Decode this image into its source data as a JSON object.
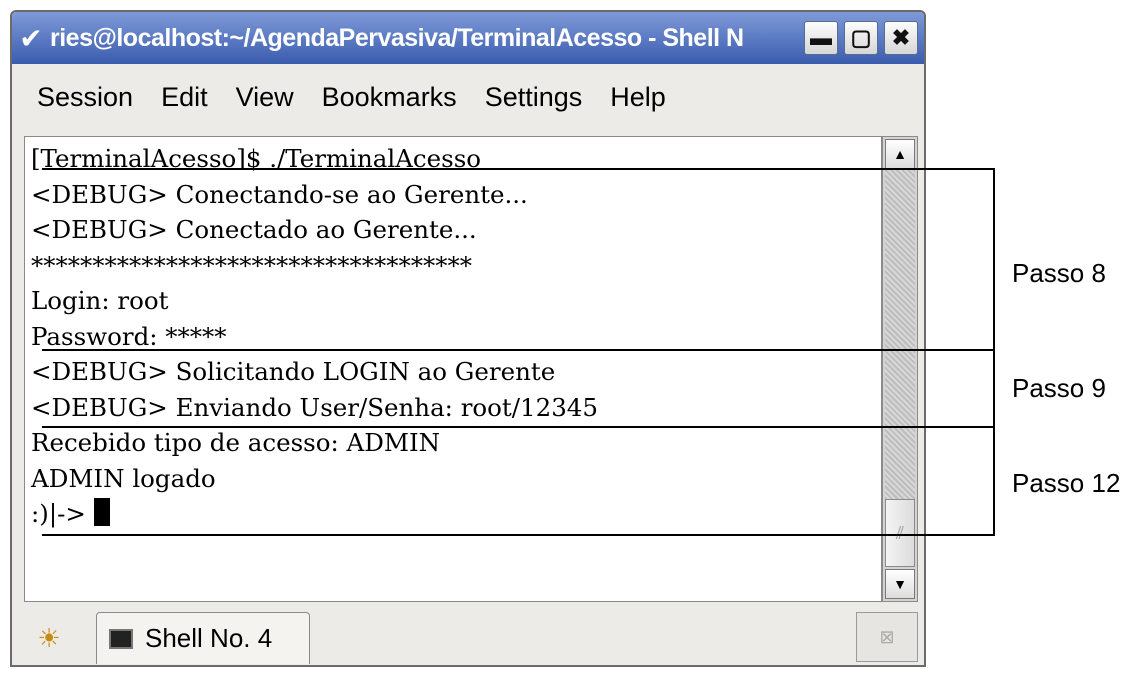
{
  "window": {
    "title": "ries@localhost:~/AgendaPervasiva/TerminalAcesso - Shell N",
    "menu_button_glyph": "✔",
    "minimize_glyph": "▬",
    "maximize_glyph": "▢",
    "close_glyph": "✖"
  },
  "menubar": {
    "items": [
      "Session",
      "Edit",
      "View",
      "Bookmarks",
      "Settings",
      "Help"
    ]
  },
  "terminal": {
    "lines": [
      "[TerminalAcesso]$ ./TerminalAcesso",
      "<DEBUG> Conectando-se ao Gerente...",
      "<DEBUG> Conectado ao Gerente...",
      "************************************",
      "Login: root",
      "Password: *****",
      "<DEBUG> Solicitando LOGIN ao Gerente",
      "<DEBUG> Enviando User/Senha: root/12345",
      "Recebido tipo de acesso: ADMIN",
      "ADMIN logado",
      ":)|-> "
    ]
  },
  "scrollbar": {
    "up_glyph": "▲",
    "down_glyph": "▼",
    "thumb_glyph": "⫽"
  },
  "tabbar": {
    "new_tab_glyph": "☀",
    "tab_label": "Shell No. 4",
    "close_tab_glyph": "⊠"
  },
  "annotations": {
    "passo8": "Passo 8",
    "passo9": "Passo 9",
    "passo12": "Passo 12"
  },
  "colors": {
    "titlebar": "#3a5cae",
    "window_bg": "#ecebe7",
    "terminal_bg": "#ffffff"
  }
}
